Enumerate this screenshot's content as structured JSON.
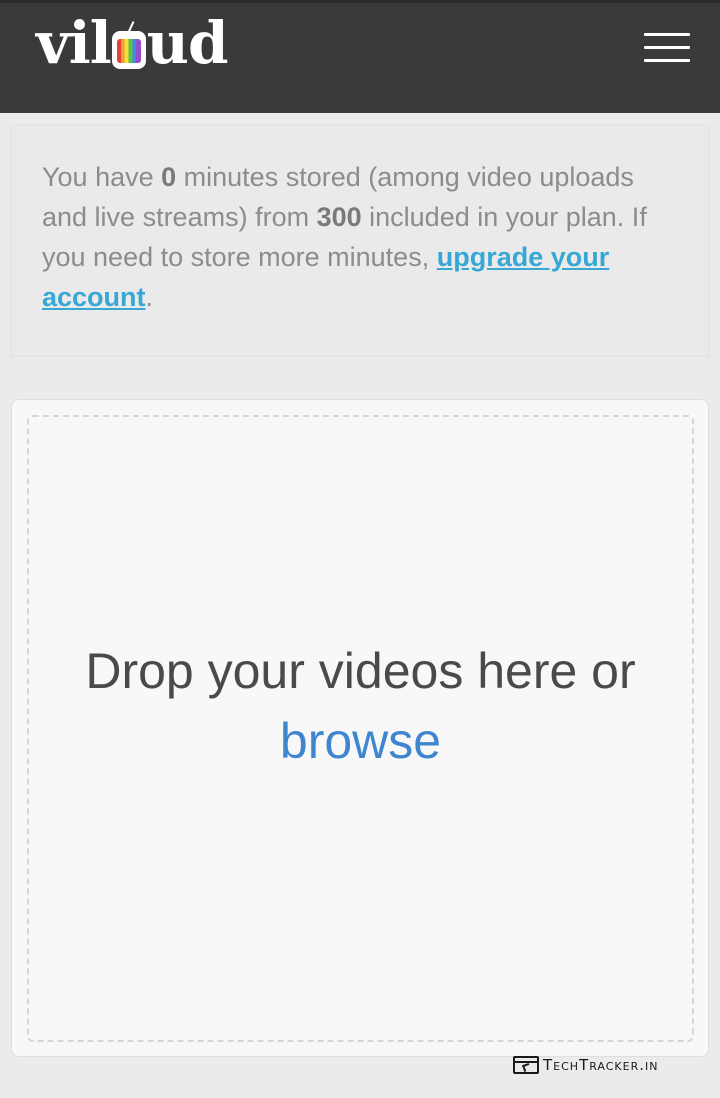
{
  "header": {
    "logo_pre": "vil",
    "logo_post": "ud",
    "menu_icon": "hamburger-menu-icon",
    "background_color": "#3a3a3a"
  },
  "storage_notice": {
    "part1": "You have ",
    "minutes_stored": "0",
    "part2": " minutes stored (among video uploads and live streams) from ",
    "minutes_included": "300",
    "part3": " included in your plan. If you need to store more minutes, ",
    "upgrade_link_label": "upgrade your account",
    "part4": ".",
    "link_color": "#37a8d6"
  },
  "upload": {
    "drop_prompt": "Drop your videos here or ",
    "browse_label": "browse",
    "browse_color": "#3f86cf"
  },
  "watermark": {
    "text": "TechTracker.in",
    "icon": "browser-cursor-icon"
  }
}
